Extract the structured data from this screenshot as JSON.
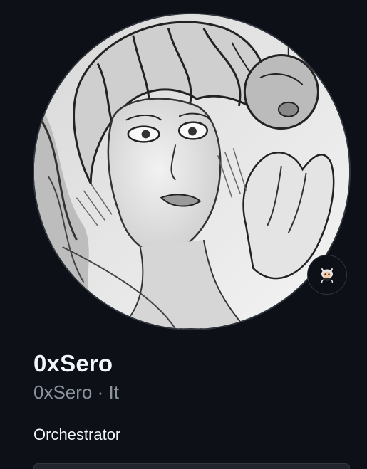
{
  "profile": {
    "display_name": "0xSero",
    "username": "0xSero",
    "separator": "·",
    "pronouns": "It",
    "bio": "Orchestrator",
    "avatar": "grayscale-manga-portrait",
    "status_icon": "octocat-icon"
  },
  "colors": {
    "background": "#0d1117",
    "text_primary": "#f0f6fc",
    "text_secondary": "#8b949e",
    "border": "#30363d"
  }
}
